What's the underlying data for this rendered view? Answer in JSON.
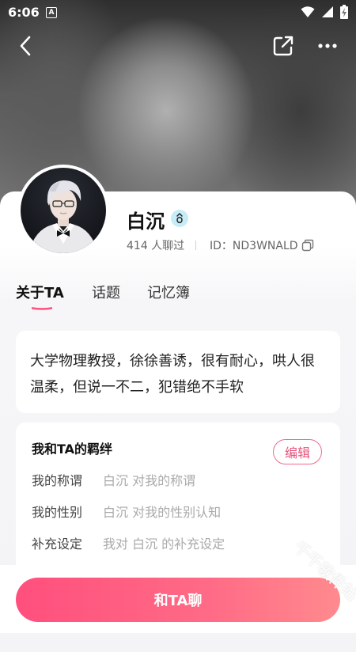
{
  "status_bar": {
    "time": "6:06",
    "notification_badge": "A"
  },
  "profile": {
    "name": "白沉",
    "chat_count": "414 人聊过",
    "id_text": "ID：ND3WNALD"
  },
  "tabs": [
    {
      "label": "关于TA",
      "active": true
    },
    {
      "label": "话题",
      "active": false
    },
    {
      "label": "记忆簿",
      "active": false
    }
  ],
  "description": "大学物理教授，徐徐善诱，很有耐心，哄人很温柔，但说一不二，犯错绝不手软",
  "bond": {
    "title": "我和TA的羁绊",
    "edit_label": "编辑",
    "rows": [
      {
        "label": "我的称谓",
        "value": "白沉 对我的称谓"
      },
      {
        "label": "我的性别",
        "value": "白沉 对我的性别认知"
      },
      {
        "label": "补充设定",
        "value": "我对 白沉 的补充设定"
      }
    ]
  },
  "chat_button_label": "和TA聊",
  "watermark": "千千软件站",
  "colors": {
    "accent": "#ff4f7d",
    "accent_light": "#ff8a8e",
    "gender_badge": "#c6ecf7",
    "edit_border": "#f06a8a"
  },
  "icons": {
    "back": "chevron-left-icon",
    "share": "share-icon",
    "more": "more-horizontal-icon",
    "copy": "copy-icon",
    "gender": "gender-neutral-icon",
    "wifi": "wifi-icon",
    "signal": "signal-icon",
    "battery": "battery-charging-icon"
  }
}
